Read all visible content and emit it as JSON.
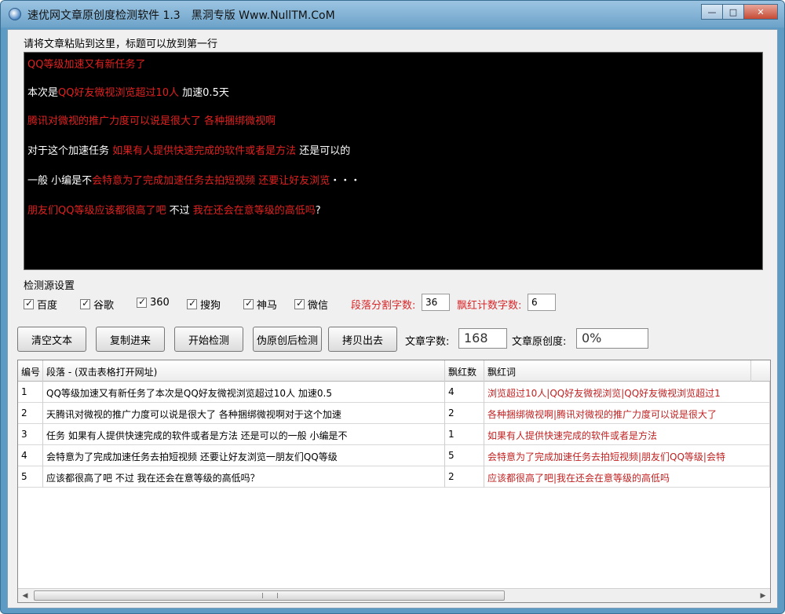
{
  "window": {
    "title": "速优网文章原创度检测软件 1.3　黑洞专版 Www.NullTM.CoM",
    "minimize_glyph": "—",
    "maximize_glyph": "□",
    "close_glyph": "✕"
  },
  "editor": {
    "label": "请将文章粘贴到这里，标题可以放到第一行",
    "lines": [
      [
        {
          "t": "QQ等级加速又有新任务了",
          "c": "red"
        }
      ],
      [
        {
          "t": "本次是",
          "c": "white"
        },
        {
          "t": "QQ好友微视浏览超过10人",
          "c": "red"
        },
        {
          "t": " 加速0.5天",
          "c": "white"
        }
      ],
      [
        {
          "t": "腾讯对微视的推广力度可以说是很大了 各种捆绑微视啊",
          "c": "red"
        }
      ],
      [
        {
          "t": "对于这个加速任务 ",
          "c": "white"
        },
        {
          "t": "如果有人提供快速完成的软件或者是方法",
          "c": "red"
        },
        {
          "t": " 还是可以的",
          "c": "white"
        }
      ],
      [
        {
          "t": "一般 小编是不",
          "c": "white"
        },
        {
          "t": "会特意为了完成加速任务去拍短视频 还要让好友浏览",
          "c": "red"
        },
        {
          "t": "・・・",
          "c": "white"
        }
      ],
      [
        {
          "t": "朋友们QQ等级应该都很高了吧",
          "c": "red"
        },
        {
          "t": " 不过 ",
          "c": "white"
        },
        {
          "t": "我在还会在意等级的高低吗",
          "c": "red"
        },
        {
          "t": "?",
          "c": "white"
        }
      ]
    ]
  },
  "sources": {
    "label": "检测源设置",
    "items": [
      "百度",
      "谷歌",
      "360",
      "搜狗",
      "神马",
      "微信"
    ],
    "split_label": "段落分割字数:",
    "split_value": "36",
    "mark_label": "飘红计数字数:",
    "mark_value": "6"
  },
  "toolbar": {
    "clear": "清空文本",
    "paste": "复制进来",
    "start": "开始检测",
    "pseudo": "伪原创后检测",
    "copy_out": "拷贝出去",
    "word_count_label": "文章字数:",
    "word_count": "168",
    "originality_label": "文章原创度:",
    "originality": "0%"
  },
  "table": {
    "headers": [
      "编号",
      "段落 - (双击表格打开网址)",
      "飘红数",
      "飘红词"
    ],
    "rows": [
      {
        "no": "1",
        "para": "QQ等级加速又有新任务了本次是QQ好友微视浏览超过10人 加速0.5",
        "count": "4",
        "kw": "浏览超过10人|QQ好友微视浏览|QQ好友微视浏览超过1"
      },
      {
        "no": "2",
        "para": "天腾讯对微视的推广力度可以说是很大了 各种捆绑微视啊对于这个加速",
        "count": "2",
        "kw": "各种捆绑微视啊|腾讯对微视的推广力度可以说是很大了"
      },
      {
        "no": "3",
        "para": "任务 如果有人提供快速完成的软件或者是方法 还是可以的一般 小编是不",
        "count": "1",
        "kw": "如果有人提供快速完成的软件或者是方法"
      },
      {
        "no": "4",
        "para": "会特意为了完成加速任务去拍短视频 还要让好友浏览一朋友们QQ等级",
        "count": "5",
        "kw": "会特意为了完成加速任务去拍短视频|朋友们QQ等级|会特"
      },
      {
        "no": "5",
        "para": "应该都很高了吧 不过 我在还会在意等级的高低吗？",
        "count": "2",
        "kw": "应该都很高了吧|我在还会在意等级的高低吗"
      }
    ]
  },
  "scrollbar": {
    "left_arrow": "◀",
    "right_arrow": "▶"
  },
  "colors": {
    "title_bar": "#6da3c9",
    "editor_bg": "#000000",
    "highlight_red": "#e02020",
    "normal_text": "#ffffff"
  }
}
